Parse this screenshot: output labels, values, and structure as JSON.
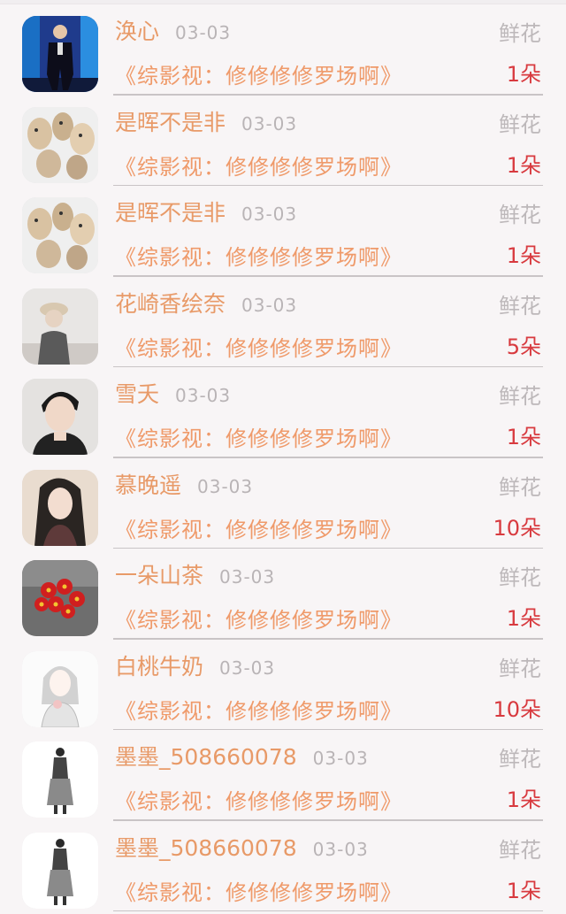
{
  "rows": [
    {
      "name": "涣心",
      "date": "03-03",
      "gift": "鲜花",
      "book": "《综影视：修修修修罗场啊》",
      "amount": "1朵",
      "avatar": "man-in-suit-avatar"
    },
    {
      "name": "是晖不是非",
      "date": "03-03",
      "gift": "鲜花",
      "book": "《综影视：修修修修罗场啊》",
      "amount": "1朵",
      "avatar": "cats-illustration-avatar"
    },
    {
      "name": "是晖不是非",
      "date": "03-03",
      "gift": "鲜花",
      "book": "《综影视：修修修修罗场啊》",
      "amount": "1朵",
      "avatar": "cats-illustration-avatar"
    },
    {
      "name": "花崎香绘奈",
      "date": "03-03",
      "gift": "鲜花",
      "book": "《综影视：修修修修罗场啊》",
      "amount": "5朵",
      "avatar": "person-with-cap-avatar"
    },
    {
      "name": "雪夭",
      "date": "03-03",
      "gift": "鲜花",
      "book": "《综影视：修修修修罗场啊》",
      "amount": "1朵",
      "avatar": "young-man-portrait-avatar"
    },
    {
      "name": "慕晚遥",
      "date": "03-03",
      "gift": "鲜花",
      "book": "《综影视：修修修修罗场啊》",
      "amount": "10朵",
      "avatar": "long-hair-illustration-avatar"
    },
    {
      "name": "一朵山茶",
      "date": "03-03",
      "gift": "鲜花",
      "book": "《综影视：修修修修罗场啊》",
      "amount": "1朵",
      "avatar": "red-flowers-avatar"
    },
    {
      "name": "白桃牛奶",
      "date": "03-03",
      "gift": "鲜花",
      "book": "《综影视：修修修修罗场啊》",
      "amount": "10朵",
      "avatar": "sketch-girl-avatar"
    },
    {
      "name": "墨墨_508660078",
      "date": "03-03",
      "gift": "鲜花",
      "book": "《综影视：修修修修罗场啊》",
      "amount": "1朵",
      "avatar": "fashion-figure-avatar"
    },
    {
      "name": "墨墨_508660078",
      "date": "03-03",
      "gift": "鲜花",
      "book": "《综影视：修修修修罗场啊》",
      "amount": "1朵",
      "avatar": "fashion-figure-avatar"
    }
  ]
}
